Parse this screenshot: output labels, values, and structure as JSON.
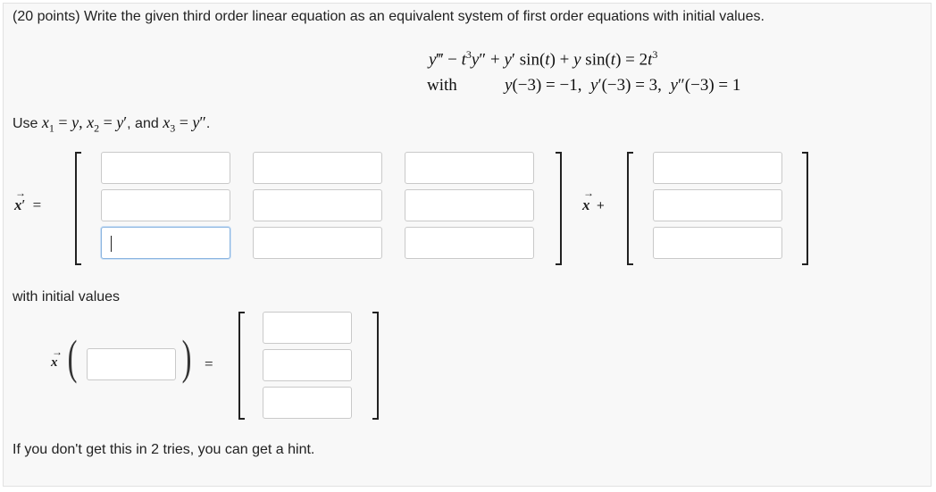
{
  "problem": {
    "statement": "(20 points) Write the given third order linear equation as an equivalent system of first order equations with initial values.",
    "with_label": "with"
  },
  "substitution": {
    "prefix": "Use",
    "and_word": ", and",
    "suffix": "."
  },
  "system": {
    "lhs_eq": "=",
    "plus": "+"
  },
  "initial": {
    "label": "with initial values",
    "eq": "="
  },
  "footer": {
    "hint_text": "If you don't get this in 2 tries, you can get a hint."
  },
  "inputs": {
    "matrix": [
      [
        "",
        "",
        ""
      ],
      [
        "",
        "",
        ""
      ],
      [
        "",
        "",
        ""
      ]
    ],
    "forcing": [
      "",
      "",
      ""
    ],
    "init_time": "",
    "init_values": [
      "",
      "",
      ""
    ]
  }
}
